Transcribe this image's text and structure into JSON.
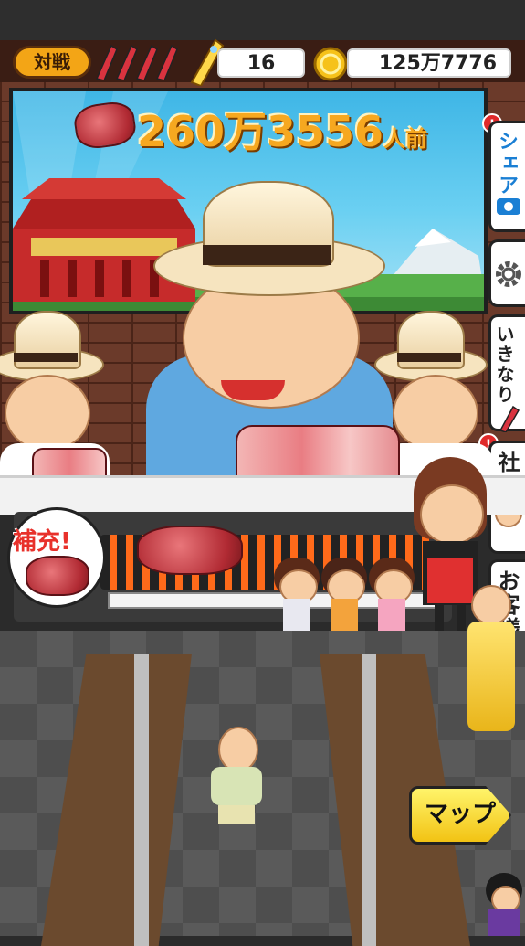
{
  "topbar": {
    "battle_label": "対戦",
    "rockets_value": "16",
    "coins_value": "125万7776"
  },
  "banner": {
    "count_number": "260万3556",
    "count_unit": "人前"
  },
  "side_tabs": {
    "share_label": "シェア",
    "ikinari_label": "いきなり",
    "president_label": "社長",
    "customer_label": "お客様",
    "alert_mark": "!"
  },
  "grill": {
    "refill_label": "補充!"
  },
  "map_button": {
    "label": "マップ"
  },
  "colors": {
    "accent_orange": "#f6a820",
    "alert_red": "#e0292a",
    "map_yellow": "#f2c314"
  },
  "icons": [
    "rocket-icon",
    "coin-icon",
    "meat-icon",
    "camera-icon",
    "gear-icon",
    "exclamation-icon"
  ]
}
